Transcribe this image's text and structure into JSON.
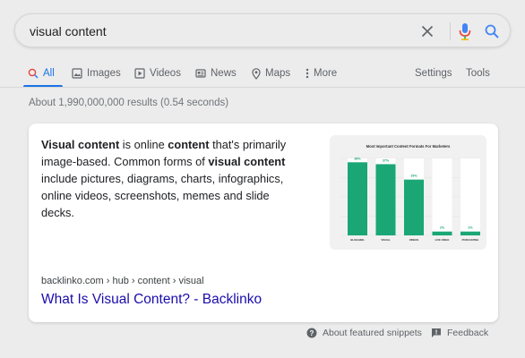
{
  "search": {
    "query": "visual content"
  },
  "tabs": [
    {
      "label": "All",
      "icon": "search-icon",
      "active": true
    },
    {
      "label": "Images",
      "icon": "image-icon"
    },
    {
      "label": "Videos",
      "icon": "play-icon"
    },
    {
      "label": "News",
      "icon": "news-icon"
    },
    {
      "label": "Maps",
      "icon": "map-pin-icon"
    },
    {
      "label": "More",
      "icon": "more-vert-icon"
    }
  ],
  "tools": {
    "settings": "Settings",
    "tools": "Tools"
  },
  "stats": "About 1,990,000,000 results (0.54 seconds)",
  "snippet": {
    "parts": [
      {
        "text": "Visual content",
        "bold": true
      },
      {
        "text": " is online ",
        "bold": false
      },
      {
        "text": "content",
        "bold": true
      },
      {
        "text": " that's primarily image-based. Common forms of ",
        "bold": false
      },
      {
        "text": "visual content",
        "bold": true
      },
      {
        "text": " include pictures, diagrams, charts, infographics, online videos, screenshots, memes and slide decks.",
        "bold": false
      }
    ]
  },
  "thumbnail": {
    "chart_data": {
      "type": "bar",
      "title": "Most Important Content Formats For Marketers",
      "categories": [
        "BLOGGING",
        "VISUAL",
        "VIDEOS",
        "LIVE VIDEO",
        "PODCASTING"
      ],
      "values": [
        38,
        37,
        29,
        2,
        2
      ],
      "value_labels": [
        "38%",
        "37%",
        "29%",
        "2%",
        "2%"
      ],
      "ylim": [
        0,
        40
      ],
      "bar_color": "#1aa775",
      "track_color": "#ffffff"
    }
  },
  "result": {
    "url": "backlinko.com › hub › content › visual",
    "title": "What Is Visual Content? - Backlinko"
  },
  "footer": {
    "about": "About featured snippets",
    "feedback": "Feedback"
  },
  "colors": {
    "accent": "#1a73e8",
    "link": "#1a0dab",
    "mic_red": "#ea4335"
  }
}
